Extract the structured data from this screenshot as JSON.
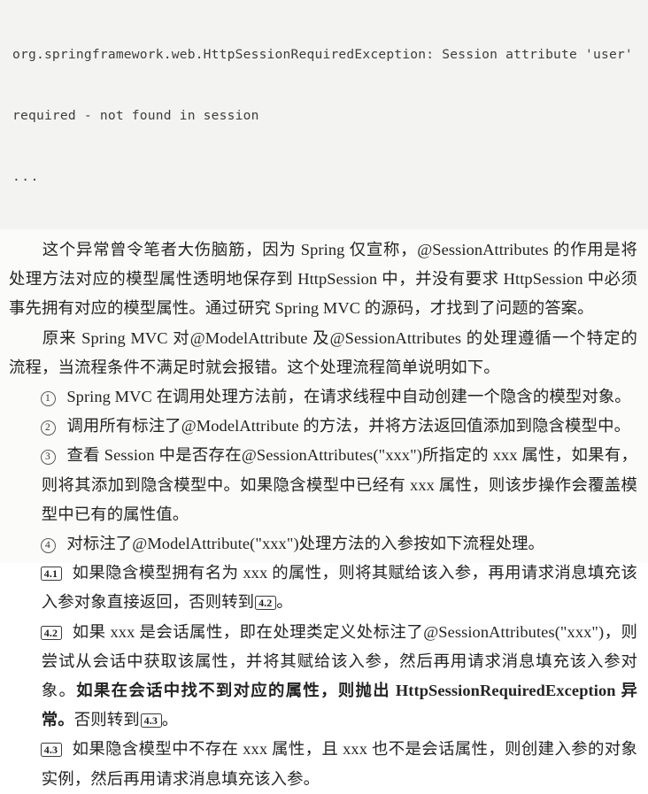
{
  "document": {
    "type": "scanned-book-page",
    "language": "zh-CN",
    "background_color": "#fbfbfa",
    "text_color": "#242424"
  },
  "code_block": {
    "background_color": "#f3f3f1",
    "lines": [
      "org.springframework.web.HttpSessionRequiredException: Session attribute 'user'",
      "required - not found in session"
    ],
    "ellipsis": "..."
  },
  "paragraphs": {
    "p1": "这个异常曾令笔者大伤脑筋，因为 Spring 仅宣称，@SessionAttributes 的作用是将处理方法对应的模型属性透明地保存到 HttpSession 中，并没有要求 HttpSession 中必须事先拥有对应的模型属性。通过研究 Spring MVC 的源码，才找到了问题的答案。",
    "p2": "原来 Spring MVC 对@ModelAttribute 及@SessionAttributes 的处理遵循一个特定的流程，当流程条件不满足时就会报错。这个处理流程简单说明如下。"
  },
  "steps": [
    {
      "marker": "1",
      "marker_style": "circle",
      "text": "Spring MVC 在调用处理方法前，在请求线程中自动创建一个隐含的模型对象。"
    },
    {
      "marker": "2",
      "marker_style": "circle",
      "text": "调用所有标注了@ModelAttribute 的方法，并将方法返回值添加到隐含模型中。"
    },
    {
      "marker": "3",
      "marker_style": "circle",
      "text": "查看 Session 中是否存在@SessionAttributes(\"xxx\")所指定的 xxx 属性，如果有，则将其添加到隐含模型中。如果隐含模型中已经有 xxx 属性，则该步操作会覆盖模型中已有的属性值。"
    },
    {
      "marker": "4",
      "marker_style": "circle",
      "text": "对标注了@ModelAttribute(\"xxx\")处理方法的入参按如下流程处理。"
    }
  ],
  "substeps": {
    "s41": {
      "marker": "4.1",
      "marker_style": "box",
      "text_before_ref": "如果隐含模型拥有名为 xxx 的属性，则将其赋给该入参，再用请求消息填充该入参对象直接返回，否则转到",
      "ref": "4.2",
      "text_after_ref": "。"
    },
    "s42": {
      "marker": "4.2",
      "marker_style": "box",
      "text_normal_1": "如果 xxx 是会话属性，即在处理类定义处标注了@SessionAttributes(\"xxx\")，则尝试从会话中获取该属性，并将其赋给该入参，然后再用请求消息填充该入参对象。",
      "text_bold_1": "如果在会话中找不到对应的属性，则抛出 ",
      "text_bold_exception": "HttpSessionRequiredException",
      "text_bold_2": " 异常。",
      "text_normal_2": "否则转到",
      "ref": "4.3",
      "text_after_ref": "。"
    },
    "s43": {
      "marker": "4.3",
      "marker_style": "box",
      "text": "如果隐含模型中不存在 xxx 属性，且 xxx 也不是会话属性，则创建入参的对象实例，然后再用请求消息填充该入参。"
    }
  }
}
